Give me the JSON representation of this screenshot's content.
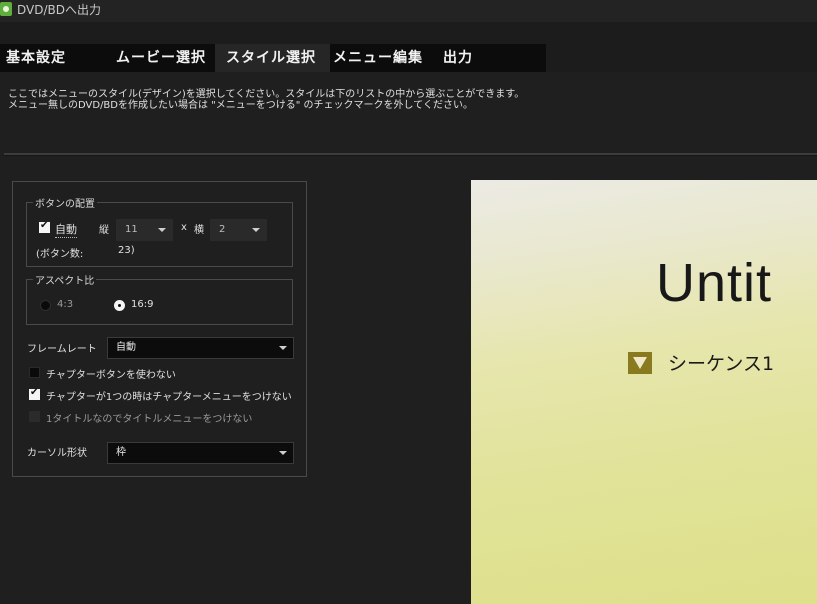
{
  "window": {
    "title": "DVD/BDへ出力"
  },
  "tabs": [
    {
      "label": "基本設定"
    },
    {
      "label": "ムービー選択"
    },
    {
      "label": "スタイル選択"
    },
    {
      "label": "メニュー編集"
    },
    {
      "label": "出力"
    }
  ],
  "active_tab": "スタイル選択",
  "description": {
    "line1": "ここではメニューのスタイル(デザイン)を選択してください。スタイルは下のリストの中から選ぶことができます。",
    "line2": "メニュー無しのDVD/BDを作成したい場合は \"メニューをつける\" のチェックマークを外してください。"
  },
  "button_layout": {
    "legend": "ボタンの配置",
    "auto_label": "自動",
    "auto_checked": true,
    "vertical_label": "縦",
    "vertical_value": "11",
    "times_label": "x",
    "horizontal_label": "横",
    "horizontal_value": "2",
    "count_label": "(ボタン数:",
    "count_value": "23)"
  },
  "aspect": {
    "legend": "アスペクト比",
    "option_43": "4:3",
    "option_169": "16:9",
    "selected": "16:9"
  },
  "frame_rate": {
    "label": "フレームレート",
    "value": "自動"
  },
  "options": {
    "no_chapter_buttons": {
      "label": "チャプターボタンを使わない",
      "checked": false
    },
    "no_chapter_menu_single": {
      "label": "チャプターが1つの時はチャプターメニューをつけない",
      "checked": true
    },
    "no_title_menu_single": {
      "label": "1タイトルなのでタイトルメニューをつけない",
      "checked": false,
      "disabled": true
    }
  },
  "cursor_shape": {
    "label": "カーソル形状",
    "value": "枠"
  },
  "preview": {
    "title": "Untit",
    "item": "シーケンス1"
  },
  "colors": {
    "background": "#1c1c1c",
    "preview_gradient_top": "#ecebe4",
    "preview_gradient_bottom": "#dee08a",
    "bullet": "#8a7a1f"
  }
}
